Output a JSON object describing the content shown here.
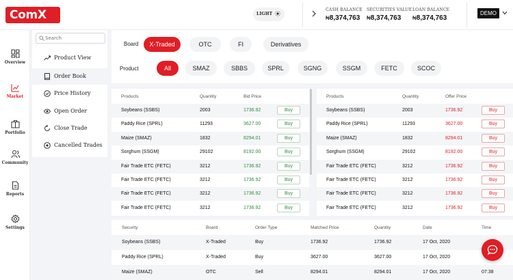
{
  "app": {
    "logo": "ComX",
    "theme_label": "LIGHT",
    "account_button": "DEMO",
    "colors": {
      "brand": "#e01e25",
      "buy_green": "#2e8a43",
      "sell_red": "#e01e25"
    }
  },
  "balances": [
    {
      "label": "CASH BALANCE",
      "currency": "₦",
      "value": "8,374,763"
    },
    {
      "label": "SECURITIES VALUE",
      "currency": "₦",
      "value": "8,374,763"
    },
    {
      "label": "LOAN BALANCE",
      "currency": "₦",
      "value": "8,374,763"
    }
  ],
  "nav": [
    {
      "label": "Overview",
      "icon": "grid-icon"
    },
    {
      "label": "Market",
      "icon": "chart-icon",
      "active": true
    },
    {
      "label": "Portfolio",
      "icon": "briefcase-icon"
    },
    {
      "label": "Community",
      "icon": "users-icon"
    },
    {
      "label": "Reports",
      "icon": "document-icon"
    },
    {
      "label": "Settings",
      "icon": "gear-icon"
    }
  ],
  "submenu": {
    "search_placeholder": "Search",
    "items": [
      {
        "label": "Product View",
        "icon": "trend-icon"
      },
      {
        "label": "Order Book",
        "icon": "book-icon",
        "active": true
      },
      {
        "label": "Price History",
        "icon": "history-icon"
      },
      {
        "label": "Open Order",
        "icon": "eye-icon"
      },
      {
        "label": "Close Trade",
        "icon": "refresh-icon"
      },
      {
        "label": "Cancelled Trades",
        "icon": "cancel-icon"
      }
    ]
  },
  "filters": {
    "board_label": "Board",
    "boards": [
      "X-Traded",
      "OTC",
      "FI",
      "Derivatives"
    ],
    "board_active": "X-Traded",
    "product_label": "Product",
    "products": [
      "All",
      "SMAZ",
      "SBBS",
      "SPRL",
      "SGNG",
      "SSGM",
      "FETC",
      "SCOC"
    ],
    "product_active": "All"
  },
  "bids": {
    "headers": [
      "Products",
      "Quantity",
      "Bid Price"
    ],
    "button_label": "Buy",
    "rows": [
      [
        "Soybeans (SSBS)",
        "2003",
        "1736.92"
      ],
      [
        "Paddy Rice (SPRL)",
        "11293",
        "3627.00"
      ],
      [
        "Maize (SMAZ)",
        "1832",
        "8294.01"
      ],
      [
        "Sorghum (SSGM)",
        "29102",
        "8192.00"
      ],
      [
        "Fair Trade ETC (FETC)",
        "3212",
        "1736.92"
      ],
      [
        "Fair Trade ETC (FETC)",
        "3212",
        "1736.92"
      ],
      [
        "Fair Trade ETC (FETC)",
        "3212",
        "1736.92"
      ],
      [
        "Fair Trade ETC (FETC)",
        "3212",
        "1736.92"
      ]
    ]
  },
  "offers": {
    "headers": [
      "Products",
      "Quantity",
      "Offer Price"
    ],
    "button_label": "Buy",
    "rows": [
      [
        "Soybeans (SSBS)",
        "2003",
        "1736.92"
      ],
      [
        "Paddy Rice (SPRL)",
        "11293",
        "3627.00"
      ],
      [
        "Maize (SMAZ)",
        "1832",
        "8294.01"
      ],
      [
        "Sorghum (SSGM)",
        "29102",
        "8192.00"
      ],
      [
        "Fair Trade ETC (FETC)",
        "3212",
        "1736.92"
      ],
      [
        "Fair Trade ETC (FETC)",
        "3212",
        "1736.92"
      ],
      [
        "Fair Trade ETC (FETC)",
        "3212",
        "1736.92"
      ],
      [
        "Fair Trade ETC (FETC)",
        "3212",
        "1736.92"
      ]
    ]
  },
  "trades": {
    "headers": [
      "Security",
      "Board",
      "Order Type",
      "Matched Price",
      "Quantity",
      "Date",
      "Time"
    ],
    "rows": [
      [
        "Soybeans (SSBS)",
        "X-Traded",
        "Buy",
        "1736.92",
        "1736.92",
        "17 Oct, 2020",
        ""
      ],
      [
        "Paddy Rice (SPRL)",
        "X-Traded",
        "Buy",
        "3627.00",
        "3627.00",
        "17 Oct, 2020",
        ""
      ],
      [
        "Maize (SMAZ)",
        "OTC",
        "Sell",
        "8294.01",
        "8294.01",
        "17 Oct, 2020",
        "07:38"
      ]
    ]
  }
}
